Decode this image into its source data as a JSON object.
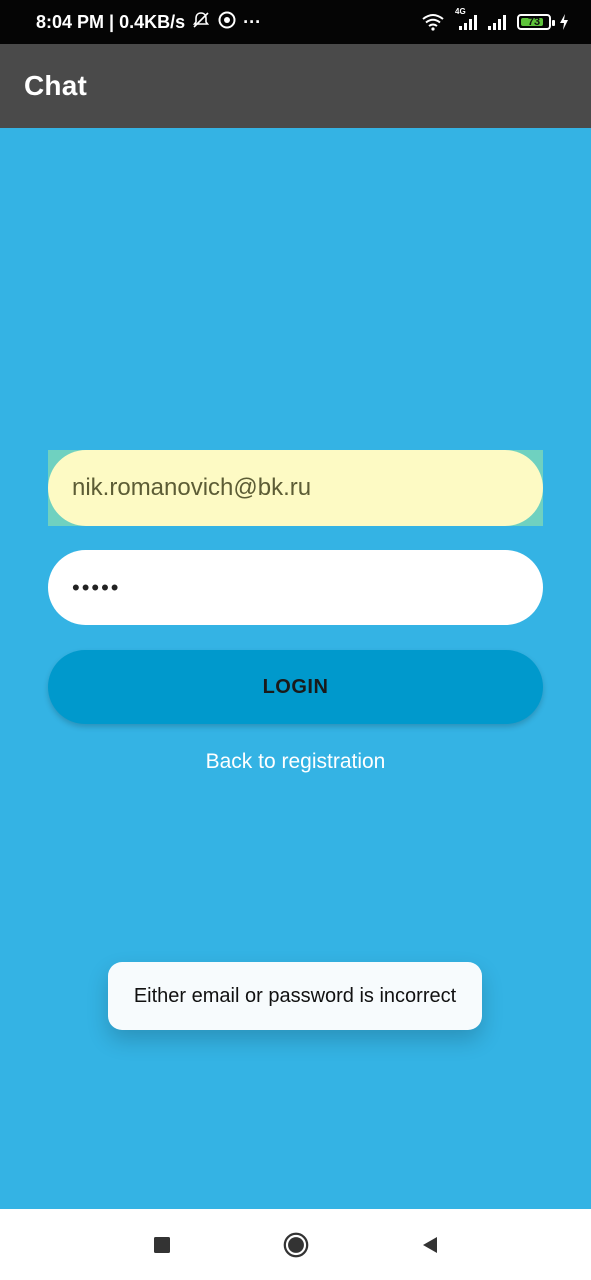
{
  "status_bar": {
    "time_speed": "8:04 PM | 0.4KB/s",
    "more": "···",
    "network_label": "4G",
    "battery_level": "73"
  },
  "app_bar": {
    "title": "Chat"
  },
  "form": {
    "email_value": "nik.romanovich@bk.ru",
    "password_value": "•••••",
    "login_label": "LOGIN",
    "back_link_label": "Back to registration"
  },
  "toast": {
    "message": "Either email or password is incorrect"
  },
  "colors": {
    "background": "#34b3e4",
    "app_bar": "#4a4a4a",
    "button": "#0099cc",
    "autofill": "#fdfac4"
  }
}
